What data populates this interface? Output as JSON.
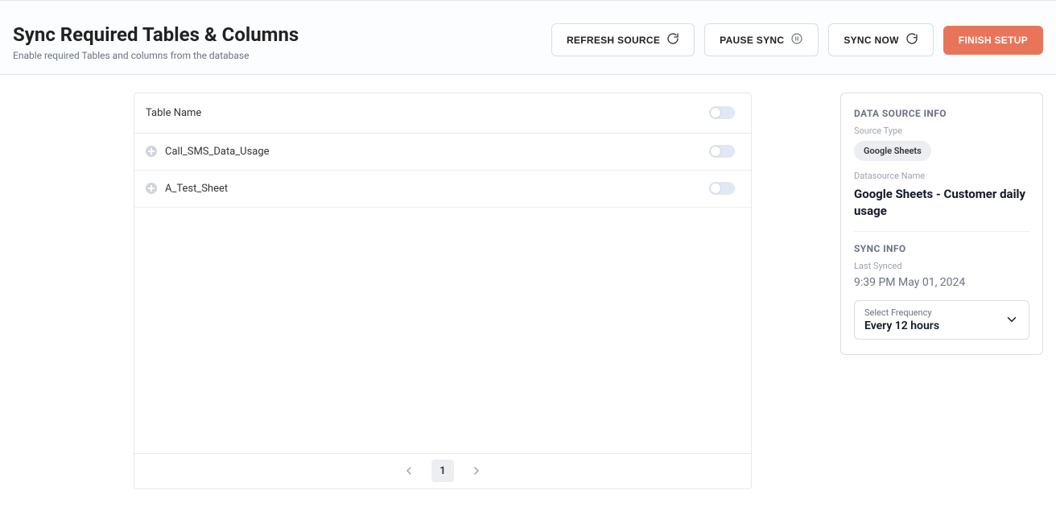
{
  "title": "Sync Required Tables & Columns",
  "subtitle": "Enable required Tables and columns from the database",
  "buttons": {
    "refresh": "REFRESH SOURCE",
    "pause": "PAUSE SYNC",
    "sync": "SYNC NOW",
    "finish": "FINISH SETUP"
  },
  "table": {
    "header": "Table Name",
    "rows": [
      {
        "name": "Call_SMS_Data_Usage",
        "enabled": false
      },
      {
        "name": "A_Test_Sheet",
        "enabled": false
      }
    ],
    "page": "1"
  },
  "info": {
    "heading": "DATA SOURCE INFO",
    "source_type_label": "Source Type",
    "source_type_value": "Google Sheets",
    "name_label": "Datasource Name",
    "name_value": "Google Sheets - Customer daily usage",
    "sync_heading": "SYNC INFO",
    "last_synced_label": "Last Synced",
    "last_synced_value": "9:39 PM May 01, 2024",
    "freq_label": "Select Frequency",
    "freq_value": "Every 12 hours"
  }
}
